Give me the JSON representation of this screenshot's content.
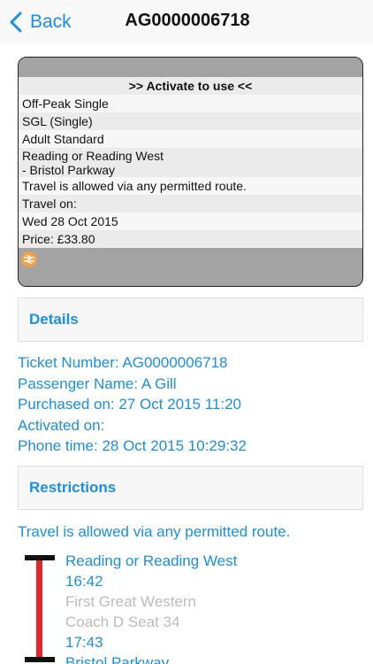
{
  "nav": {
    "back_label": "Back",
    "title": "AG0000006718"
  },
  "ticket": {
    "activate_label": ">> Activate to use <<",
    "rows": [
      "Off-Peak Single",
      "SGL (Single)",
      "Adult Standard",
      "Reading or Reading West",
      "- Bristol Parkway",
      "Travel is allowed via any permitted route.",
      "Travel on:",
      "Wed 28 Oct 2015",
      "Price: £33.80"
    ]
  },
  "details": {
    "heading": "Details",
    "ticket_number": "Ticket Number: AG0000006718",
    "passenger_name": "Passenger Name: A Gill",
    "purchased_on": "Purchased on: 27 Oct 2015 11:20",
    "activated_on": "Activated on:",
    "phone_time": "Phone time: 28 Oct 2015 10:29:32"
  },
  "restrictions": {
    "heading": "Restrictions",
    "text": "Travel is allowed via any permitted route."
  },
  "journey": {
    "from_station": "Reading or Reading West",
    "depart_time": "16:42",
    "operator": "First Great Western",
    "seat": "Coach D Seat 34",
    "arrive_time": "17:43",
    "to_station": "Bristol Parkway"
  },
  "colors": {
    "accent": "#1a8fe3",
    "route_line": "#e4252b",
    "ticket_frame": "#a3a3a3"
  }
}
